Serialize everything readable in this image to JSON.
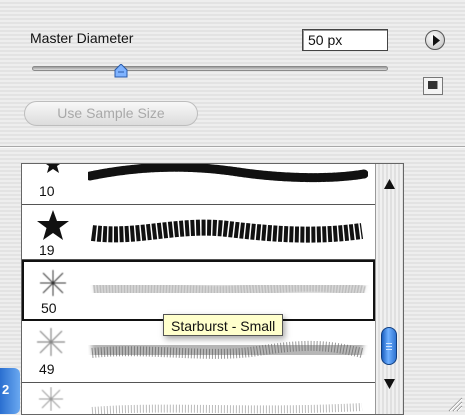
{
  "master": {
    "label": "Master Diameter",
    "value": "50 px",
    "slider_fraction": 0.25
  },
  "sample_button": "Use Sample Size",
  "brushes": [
    {
      "size": "10",
      "tip": "star",
      "stroke": "dark"
    },
    {
      "size": "19",
      "tip": "star",
      "stroke": "dark"
    },
    {
      "size": "50",
      "tip": "starburst",
      "stroke": "soft",
      "selected": true
    },
    {
      "size": "49",
      "tip": "starburst",
      "stroke": "soft"
    }
  ],
  "tooltip": "Starburst - Small",
  "side_tab_label": "2",
  "icons": {
    "menu": "panel-menu-arrow-icon",
    "new_brush": "new-brush-icon",
    "scroll_up": "scroll-up-arrow-icon",
    "scroll_down": "scroll-down-arrow-icon",
    "resize": "resize-grip-icon"
  },
  "colors": {
    "scroll_thumb": "#2f74d2",
    "tooltip_bg": "#ffffcc"
  }
}
